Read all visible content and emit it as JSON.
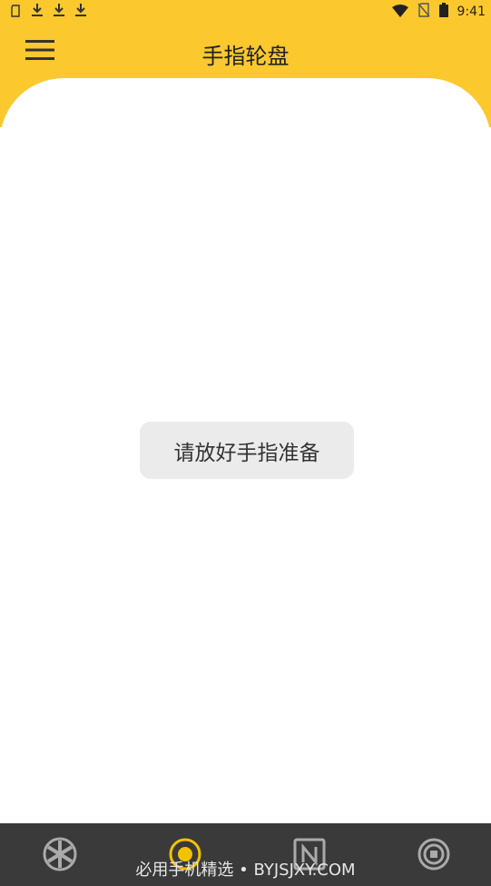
{
  "status_bar": {
    "time": "9:41",
    "icons": [
      "sim-card-icon",
      "download-icon",
      "download-icon",
      "download-icon",
      "wifi-icon",
      "no-sim-icon",
      "battery-icon"
    ]
  },
  "app_bar": {
    "title": "手指轮盘",
    "menu_icon": "hamburger-menu-icon"
  },
  "main": {
    "toast_text": "请放好手指准备"
  },
  "bottom_nav": {
    "items": [
      {
        "icon": "wheel-icon",
        "active": false
      },
      {
        "icon": "target-icon",
        "active": true
      },
      {
        "icon": "n-box-icon",
        "active": false
      },
      {
        "icon": "stop-circle-icon",
        "active": false
      }
    ],
    "watermark": "必用手机精选 • BYJSJXY.COM"
  },
  "colors": {
    "accent": "#fbc82e",
    "bottom_bar": "#3a3a3a",
    "active_icon": "#f2c200"
  }
}
